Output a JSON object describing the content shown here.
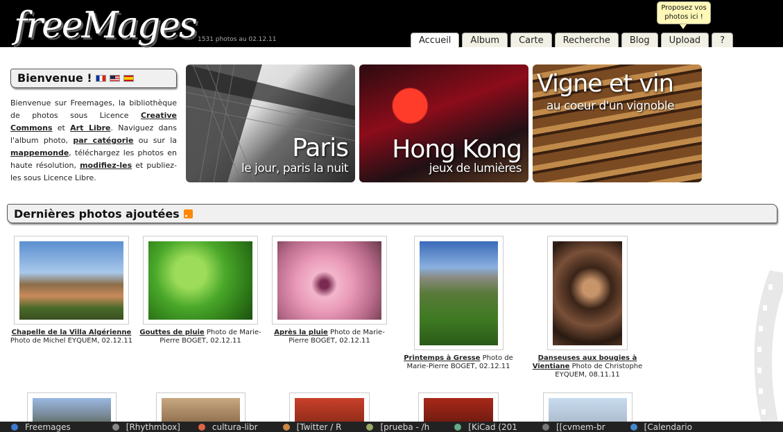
{
  "header": {
    "logo": "freeMages",
    "photo_count": "1531 photos au 02.12.11",
    "tabs": [
      "Accueil",
      "Album",
      "Carte",
      "Recherche",
      "Blog",
      "Upload",
      "?"
    ],
    "tooltip": "Proposez vos photos ici !"
  },
  "welcome": {
    "title": "Bienvenue !",
    "flags": [
      "fr-flag-icon",
      "us-flag-icon",
      "es-flag-icon"
    ],
    "text_1": "Bienvenue sur Freemages, la bibliothèque de photos sous Licence ",
    "link_cc": "Creative Commons",
    "text_2": " et ",
    "link_art": "Art Libre",
    "text_3": ". Naviguez dans l'album photo, ",
    "link_cat": "par catégorie",
    "text_4": " ou sur la ",
    "link_map": "mappemonde",
    "text_5": ", téléchargez les photos en haute résolution, ",
    "link_edit": "modifiez-les",
    "text_6": " et publiez-les sous Licence Libre."
  },
  "banners": [
    {
      "title": "Paris",
      "subtitle": "le jour, paris la nuit"
    },
    {
      "title": "Hong Kong",
      "subtitle": "jeux de lumières"
    },
    {
      "title": "Vigne et vin",
      "subtitle": "au coeur d'un vignoble"
    }
  ],
  "latest": {
    "title": "Dernières photos ajoutées",
    "photos": [
      {
        "title": "Chapelle de la Villa Algérienne",
        "credit": "Photo de Michel EYQUEM, 02.12.11"
      },
      {
        "title": "Gouttes de pluie",
        "credit": " Photo de Marie-Pierre BOGET, 02.12.11"
      },
      {
        "title": "Après la pluie",
        "credit": " Photo de Marie-Pierre BOGET, 02.12.11"
      },
      {
        "title": "Printemps à Gresse",
        "credit": " Photo de Marie-Pierre BOGET, 02.12.11"
      },
      {
        "title": "Danseuses aux bougies à Vientiane",
        "credit": " Photo de Christophe EYQUEM, 08.11.11"
      }
    ]
  },
  "taskbar": {
    "items": [
      "Freemages",
      "[Rhythmbox]",
      "cultura-libr",
      "[Twitter / R",
      "[prueba - /h",
      "[KiCad (201",
      "[[cvmem-br",
      "[Calendario"
    ]
  }
}
